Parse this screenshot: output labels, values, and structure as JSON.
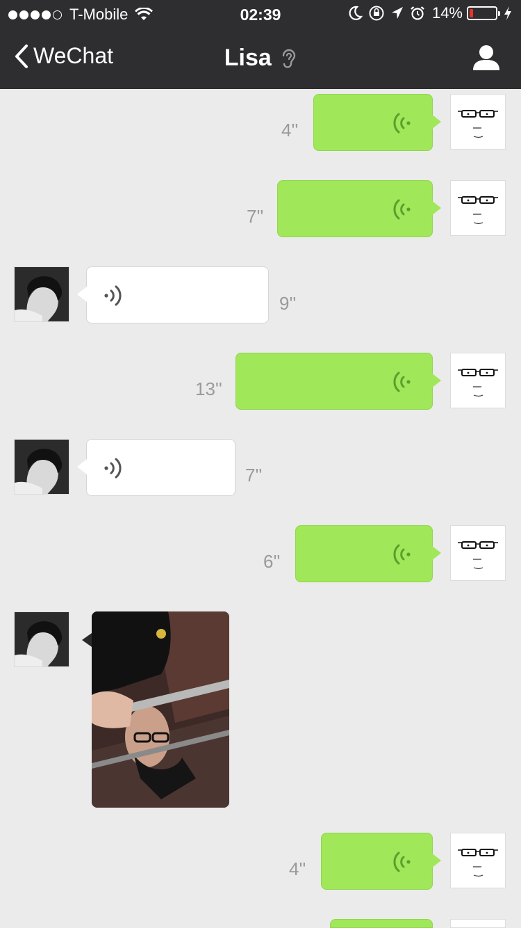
{
  "status_bar": {
    "carrier": "T-Mobile",
    "time": "02:39",
    "battery": "14%",
    "signal_dots_filled": 4,
    "signal_dots_total": 5
  },
  "nav": {
    "back_label": "WeChat",
    "title": "Lisa",
    "icons": [
      "chevron-left-icon",
      "ear-icon",
      "profile-icon"
    ]
  },
  "messages": [
    {
      "direction": "sent",
      "type": "voice",
      "duration": "4''"
    },
    {
      "direction": "sent",
      "type": "voice",
      "duration": "7''"
    },
    {
      "direction": "received",
      "type": "voice",
      "duration": "9''"
    },
    {
      "direction": "sent",
      "type": "voice",
      "duration": "13''"
    },
    {
      "direction": "received",
      "type": "voice",
      "duration": "7''"
    },
    {
      "direction": "sent",
      "type": "voice",
      "duration": "6''"
    },
    {
      "direction": "received",
      "type": "image"
    },
    {
      "direction": "sent",
      "type": "voice",
      "duration": "4''"
    },
    {
      "direction": "sent",
      "type": "voice"
    }
  ],
  "colors": {
    "nav_bg": "#2e2e31",
    "chat_bg": "#ebebeb",
    "sent_bubble": "#a0e75a",
    "received_bubble": "#ffffff",
    "duration_text": "#9a9a9a",
    "battery_low": "#e8332a"
  }
}
